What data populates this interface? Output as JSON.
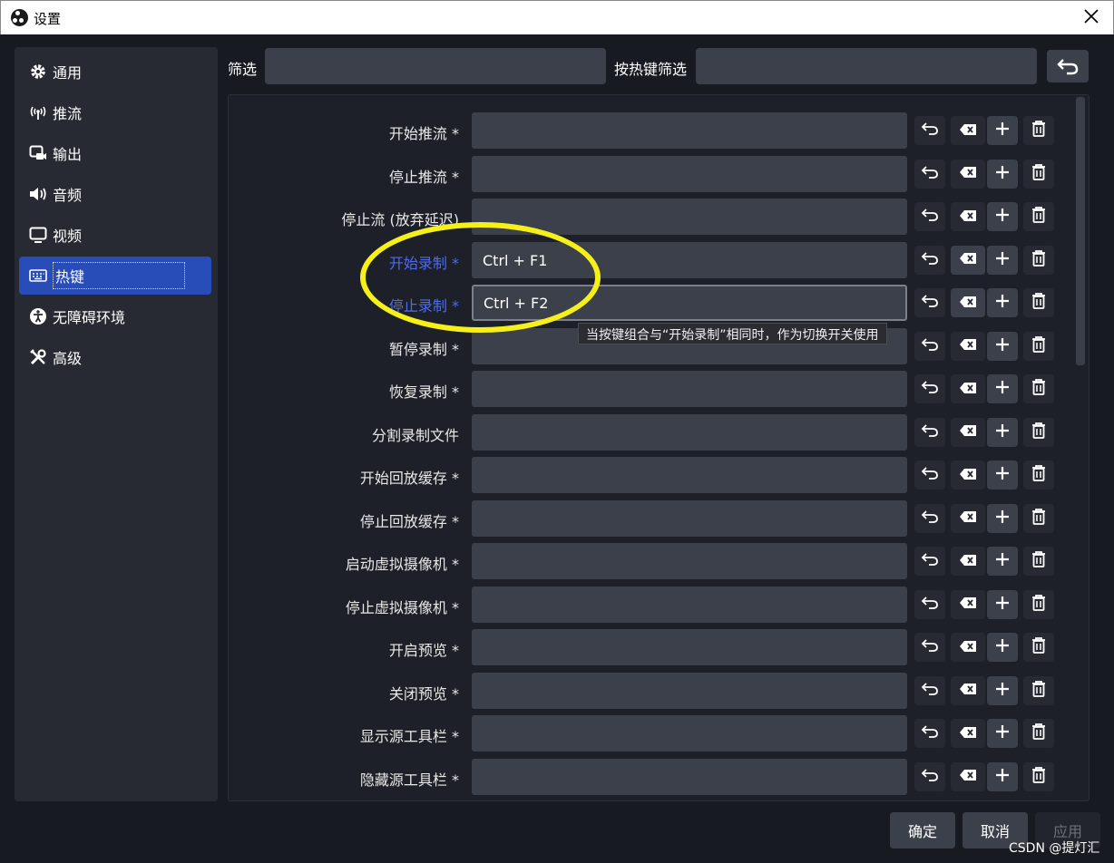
{
  "window": {
    "title": "设置"
  },
  "sidebar": {
    "items": [
      {
        "label": "通用",
        "icon": "gear-icon"
      },
      {
        "label": "推流",
        "icon": "antenna-icon"
      },
      {
        "label": "输出",
        "icon": "output-icon"
      },
      {
        "label": "音频",
        "icon": "speaker-icon"
      },
      {
        "label": "视频",
        "icon": "monitor-icon"
      },
      {
        "label": "热键",
        "icon": "keyboard-icon",
        "active": true
      },
      {
        "label": "无障碍环境",
        "icon": "accessibility-icon"
      },
      {
        "label": "高级",
        "icon": "tools-icon"
      }
    ]
  },
  "filter": {
    "label": "筛选",
    "value": "",
    "hotkey_label": "按热键筛选",
    "hotkey_value": ""
  },
  "hotkeys": [
    {
      "label": "开始推流 *",
      "key": ""
    },
    {
      "label": "停止推流 *",
      "key": ""
    },
    {
      "label": "停止流 (放弃延迟)",
      "key": ""
    },
    {
      "label": "开始录制 *",
      "key": "Ctrl + F1",
      "highlighted": true
    },
    {
      "label": "停止录制 *",
      "key": "Ctrl + F2",
      "highlighted": true,
      "focused": true
    },
    {
      "label": "暂停录制 *",
      "key": ""
    },
    {
      "label": "恢复录制 *",
      "key": ""
    },
    {
      "label": "分割录制文件",
      "key": ""
    },
    {
      "label": "开始回放缓存 *",
      "key": ""
    },
    {
      "label": "停止回放缓存 *",
      "key": ""
    },
    {
      "label": "启动虚拟摄像机 *",
      "key": ""
    },
    {
      "label": "停止虚拟摄像机 *",
      "key": ""
    },
    {
      "label": "开启预览 *",
      "key": ""
    },
    {
      "label": "关闭预览 *",
      "key": ""
    },
    {
      "label": "显示源工具栏 *",
      "key": ""
    },
    {
      "label": "隐藏源工具栏 *",
      "key": ""
    }
  ],
  "tooltip": "当按键组合与“开始录制”相同时，作为切换开关使用",
  "buttons": {
    "ok": "确定",
    "cancel": "取消",
    "apply": "应用"
  },
  "watermark": "CSDN @提灯汇",
  "colors": {
    "active_nav": "#284cb8",
    "highlight_label": "#4a6cf0",
    "annotation": "#f6f01a"
  }
}
